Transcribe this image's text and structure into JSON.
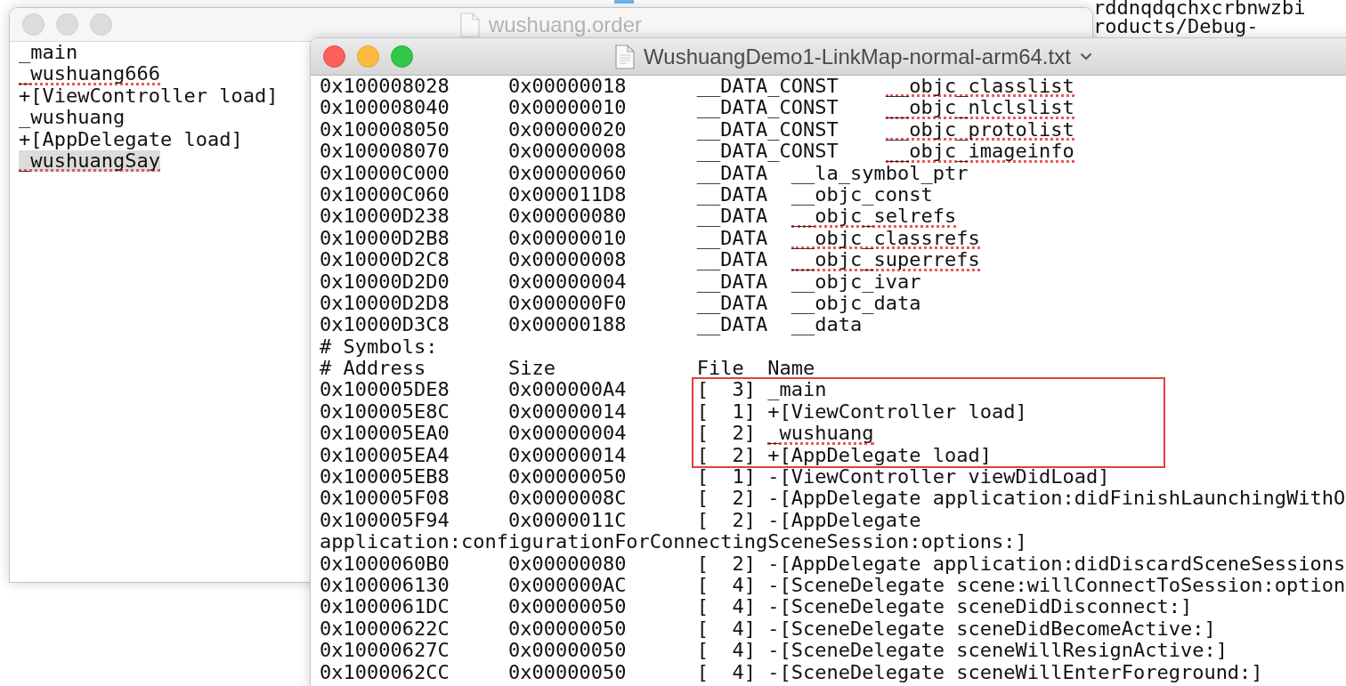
{
  "background_window": {
    "text_lines": [
      "rddnqdqchxcrbnwzbi",
      "roducts/Debug-"
    ]
  },
  "order_window": {
    "title": "wushuang.order",
    "lines": [
      {
        "text": "_main",
        "flagged": false,
        "selected": false
      },
      {
        "text": "_wushuang666",
        "flagged": true,
        "selected": false
      },
      {
        "text": "+[ViewController load]",
        "flagged": false,
        "selected": false
      },
      {
        "text": "_wushuang",
        "flagged": false,
        "selected": false
      },
      {
        "text": "+[AppDelegate load]",
        "flagged": false,
        "selected": false
      },
      {
        "text": "_wushuangSay",
        "flagged": true,
        "selected": true
      }
    ]
  },
  "linkmap_window": {
    "title": "WushuangDemo1-LinkMap-normal-arm64.txt",
    "rows": [
      {
        "kind": "section",
        "address": "0x100008028",
        "size": "0x00000018",
        "segment": "__DATA_CONST",
        "section": "__objc_classlist",
        "flagged": true
      },
      {
        "kind": "section",
        "address": "0x100008040",
        "size": "0x00000010",
        "segment": "__DATA_CONST",
        "section": "__objc_nlclslist",
        "flagged": true
      },
      {
        "kind": "section",
        "address": "0x100008050",
        "size": "0x00000020",
        "segment": "__DATA_CONST",
        "section": "__objc_protolist",
        "flagged": true
      },
      {
        "kind": "section",
        "address": "0x100008070",
        "size": "0x00000008",
        "segment": "__DATA_CONST",
        "section": "__objc_imageinfo",
        "flagged": true
      },
      {
        "kind": "section",
        "address": "0x10000C000",
        "size": "0x00000060",
        "segment": "__DATA",
        "section": "__la_symbol_ptr",
        "flagged": false
      },
      {
        "kind": "section",
        "address": "0x10000C060",
        "size": "0x000011D8",
        "segment": "__DATA",
        "section": "__objc_const",
        "flagged": false
      },
      {
        "kind": "section",
        "address": "0x10000D238",
        "size": "0x00000080",
        "segment": "__DATA",
        "section": "__objc_selrefs",
        "flagged": true
      },
      {
        "kind": "section",
        "address": "0x10000D2B8",
        "size": "0x00000010",
        "segment": "__DATA",
        "section": "__objc_classrefs",
        "flagged": true
      },
      {
        "kind": "section",
        "address": "0x10000D2C8",
        "size": "0x00000008",
        "segment": "__DATA",
        "section": "__objc_superrefs",
        "flagged": true
      },
      {
        "kind": "section",
        "address": "0x10000D2D0",
        "size": "0x00000004",
        "segment": "__DATA",
        "section": "__objc_ivar",
        "flagged": false
      },
      {
        "kind": "section",
        "address": "0x10000D2D8",
        "size": "0x000000F0",
        "segment": "__DATA",
        "section": "__objc_data",
        "flagged": false
      },
      {
        "kind": "section",
        "address": "0x10000D3C8",
        "size": "0x00000188",
        "segment": "__DATA",
        "section": "__data",
        "flagged": false
      },
      {
        "kind": "comment",
        "text": "# Symbols:"
      },
      {
        "kind": "header",
        "address": "# Address",
        "size": "Size",
        "file": "File",
        "name": "Name"
      },
      {
        "kind": "symbol",
        "address": "0x100005DE8",
        "size": "0x000000A4",
        "file": "[  3]",
        "name": "_main",
        "flagged": false,
        "boxed": true
      },
      {
        "kind": "symbol",
        "address": "0x100005E8C",
        "size": "0x00000014",
        "file": "[  1]",
        "name": "+[ViewController load]",
        "flagged": false,
        "boxed": true
      },
      {
        "kind": "symbol",
        "address": "0x100005EA0",
        "size": "0x00000004",
        "file": "[  2]",
        "name": "_wushuang",
        "flagged": true,
        "boxed": true
      },
      {
        "kind": "symbol",
        "address": "0x100005EA4",
        "size": "0x00000014",
        "file": "[  2]",
        "name": "+[AppDelegate load]",
        "flagged": false,
        "boxed": true
      },
      {
        "kind": "symbol",
        "address": "0x100005EB8",
        "size": "0x00000050",
        "file": "[  1]",
        "name": "-[ViewController viewDidLoad]",
        "flagged": false,
        "boxed": false
      },
      {
        "kind": "symbol",
        "address": "0x100005F08",
        "size": "0x0000008C",
        "file": "[  2]",
        "name": "-[AppDelegate application:didFinishLaunchingWithO",
        "flagged": false,
        "boxed": false
      },
      {
        "kind": "symbol",
        "address": "0x100005F94",
        "size": "0x0000011C",
        "file": "[  2]",
        "name": "-[AppDelegate",
        "flagged": false,
        "boxed": false
      },
      {
        "kind": "wrap",
        "text": "application:configurationForConnectingSceneSession:options:]"
      },
      {
        "kind": "symbol",
        "address": "0x1000060B0",
        "size": "0x00000080",
        "file": "[  2]",
        "name": "-[AppDelegate application:didDiscardSceneSessions",
        "flagged": false,
        "boxed": false
      },
      {
        "kind": "symbol",
        "address": "0x100006130",
        "size": "0x000000AC",
        "file": "[  4]",
        "name": "-[SceneDelegate scene:willConnectToSession:option",
        "flagged": false,
        "boxed": false
      },
      {
        "kind": "symbol",
        "address": "0x1000061DC",
        "size": "0x00000050",
        "file": "[  4]",
        "name": "-[SceneDelegate sceneDidDisconnect:]",
        "flagged": false,
        "boxed": false
      },
      {
        "kind": "symbol",
        "address": "0x10000622C",
        "size": "0x00000050",
        "file": "[  4]",
        "name": "-[SceneDelegate sceneDidBecomeActive:]",
        "flagged": false,
        "boxed": false
      },
      {
        "kind": "symbol",
        "address": "0x10000627C",
        "size": "0x00000050",
        "file": "[  4]",
        "name": "-[SceneDelegate sceneWillResignActive:]",
        "flagged": false,
        "boxed": false
      },
      {
        "kind": "symbol",
        "address": "0x1000062CC",
        "size": "0x00000050",
        "file": "[  4]",
        "name": "-[SceneDelegate sceneWillEnterForeground:]",
        "flagged": false,
        "boxed": false
      }
    ]
  }
}
